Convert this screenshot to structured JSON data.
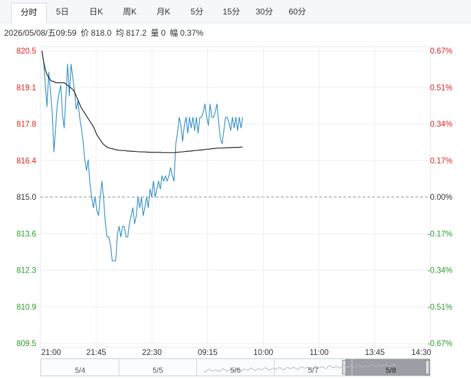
{
  "tabs": [
    {
      "label": "分时",
      "active": true
    },
    {
      "label": "5日",
      "active": false
    },
    {
      "label": "日K",
      "active": false
    },
    {
      "label": "周K",
      "active": false
    },
    {
      "label": "月K",
      "active": false
    },
    {
      "label": "5分",
      "active": false
    },
    {
      "label": "15分",
      "active": false
    },
    {
      "label": "30分",
      "active": false
    },
    {
      "label": "60分",
      "active": false
    }
  ],
  "info": {
    "datetime": "2026/05/08/五09:59",
    "price_label": "价",
    "price": "818.0",
    "avg_label": "均",
    "avg": "817.2",
    "vol_label": "量",
    "vol": "0",
    "change_label": "幅",
    "change": "0.37%"
  },
  "colors": {
    "up": "#e01f1f",
    "down": "#2a9d2a",
    "price_line": "#2a8bc8",
    "avg_line": "#222222"
  },
  "chart_data": {
    "type": "line",
    "y_ticks": [
      "820.5",
      "819.1",
      "817.8",
      "816.4",
      "815.0",
      "813.6",
      "812.3",
      "810.9",
      "809.5"
    ],
    "pct_ticks": [
      "0.67%",
      "0.51%",
      "0.34%",
      "0.17%",
      "0.00%",
      "-0.17%",
      "-0.34%",
      "-0.51%",
      "-0.67%"
    ],
    "x_ticks": [
      "21:00",
      "21:45",
      "22:30",
      "09:15",
      "10:00",
      "11:00",
      "13:45",
      "14:30"
    ],
    "ylim": [
      809.5,
      820.5
    ],
    "base": 815.0,
    "series": [
      {
        "values": [
          820.5,
          820.1,
          819.2,
          818.4,
          819.7,
          819.0,
          818.2,
          816.7,
          817.6,
          818.5,
          818.9,
          819.2,
          818.1,
          817.6,
          818.8,
          820.0,
          818.8,
          820.0,
          819.5,
          819.0,
          818.3,
          818.6,
          818.0,
          817.6,
          817.1,
          816.4,
          816.0,
          816.4,
          815.5,
          815.0,
          814.6,
          815.0,
          814.5,
          814.3,
          815.0,
          815.6,
          814.9,
          814.0,
          813.5,
          813.5,
          813.2,
          812.6,
          812.6,
          812.6,
          813.6,
          813.9,
          813.5,
          813.9,
          813.9,
          813.5,
          813.5,
          814.0,
          814.3,
          814.6,
          814.0,
          814.3,
          815.0,
          814.6,
          815.0,
          814.3,
          814.6,
          815.0,
          814.6,
          815.3,
          815.0,
          815.6,
          815.0,
          815.3,
          815.6,
          815.3,
          815.8,
          815.6,
          815.8,
          815.6,
          815.8,
          816.1,
          815.8,
          815.6,
          817.0,
          817.4,
          818.0,
          817.7,
          817.1,
          817.7,
          818.0,
          817.4,
          818.0,
          817.6,
          818.0,
          817.5,
          818.0,
          817.4,
          818.0,
          818.0,
          818.2,
          818.5,
          818.0,
          817.7,
          818.5,
          818.0,
          818.0,
          818.2,
          818.5,
          817.8,
          817.2,
          817.0,
          817.5,
          818.0,
          818.0,
          817.8,
          817.5,
          818.0,
          817.6,
          818.0,
          817.5,
          818.0,
          817.6,
          818.0
        ]
      },
      {
        "values": [
          820.5,
          820.1,
          819.8,
          819.6,
          819.5,
          819.4,
          819.35,
          819.35,
          819.3,
          819.3,
          819.3,
          819.3,
          819.3,
          819.3,
          819.25,
          819.2,
          819.15,
          819.1,
          819.05,
          818.95,
          818.8,
          818.65,
          818.5,
          818.35,
          818.25,
          818.15,
          818.05,
          817.95,
          817.85,
          817.75,
          817.65,
          817.5,
          817.35,
          817.25,
          817.15,
          817.05,
          816.98,
          816.92,
          816.88,
          816.85,
          816.83,
          816.82,
          816.8,
          816.78,
          816.77,
          816.76,
          816.75,
          816.75,
          816.75,
          816.74,
          816.73,
          816.73,
          816.72,
          816.72,
          816.72,
          816.71,
          816.71,
          816.7,
          816.7,
          816.7,
          816.7,
          816.69,
          816.69,
          816.69,
          816.68,
          816.68,
          816.68,
          816.68,
          816.68,
          816.68,
          816.67,
          816.67,
          816.67,
          816.67,
          816.67,
          816.67,
          816.67,
          816.67,
          816.68,
          816.68,
          816.69,
          816.7,
          816.7,
          816.71,
          816.72,
          816.72,
          816.73,
          816.73,
          816.74,
          816.75,
          816.75,
          816.76,
          816.77,
          816.77,
          816.78,
          816.79,
          816.8,
          816.8,
          816.81,
          816.82,
          816.82,
          816.83,
          816.84,
          816.84,
          816.84,
          816.84,
          816.85,
          816.85,
          816.85,
          816.86,
          816.86,
          816.86,
          816.87,
          816.87,
          816.87,
          816.87,
          816.88,
          816.88
        ]
      }
    ],
    "navigator_labels": [
      "5/4",
      "5/5",
      "5/6",
      "5/7",
      "5/8"
    ]
  }
}
